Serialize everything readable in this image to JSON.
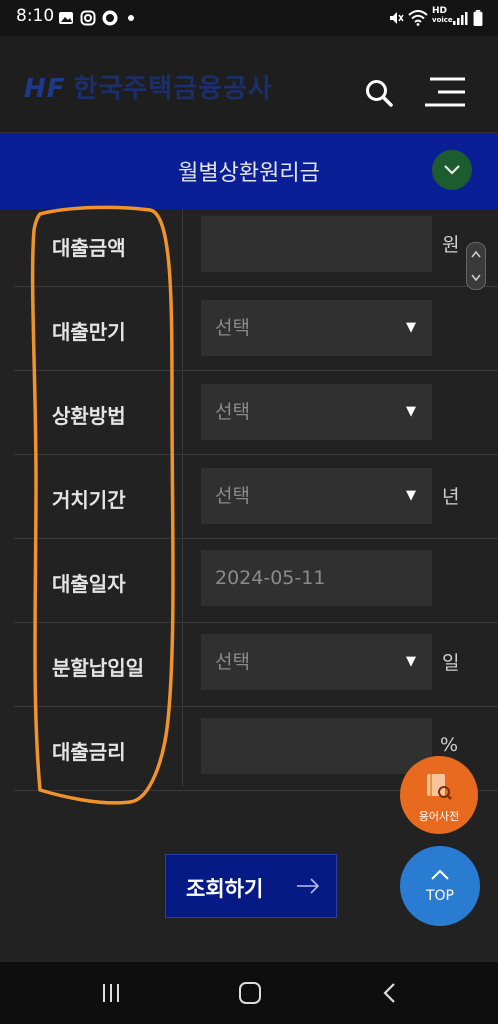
{
  "status_bar": {
    "time": "8:10",
    "icons": [
      "gallery-icon",
      "instagram-icon",
      "notification-icon",
      "dot-icon",
      "mute-icon",
      "wifi-icon",
      "hd-voice-icon",
      "signal-icon",
      "battery-icon"
    ],
    "hd_label": "HD",
    "voice_label": "voice"
  },
  "header": {
    "logo_mark": "HF",
    "logo_text": "한국주택금융공사",
    "icons": [
      "search-icon",
      "menu-icon"
    ]
  },
  "page": {
    "title": "월별상환원리금"
  },
  "form": {
    "rows": [
      {
        "label": "대출금액",
        "value": "",
        "unit": "원",
        "type": "input"
      },
      {
        "label": "대출만기",
        "value": "선택",
        "unit": "",
        "type": "select"
      },
      {
        "label": "상환방법",
        "value": "선택",
        "unit": "",
        "type": "select"
      },
      {
        "label": "거치기간",
        "value": "선택",
        "unit": "년",
        "type": "select"
      },
      {
        "label": "대출일자",
        "value": "2024-05-11",
        "unit": "",
        "type": "date"
      },
      {
        "label": "분할납입일",
        "value": "선택",
        "unit": "일",
        "type": "select"
      },
      {
        "label": "대출금리",
        "value": "",
        "unit": "%",
        "type": "input"
      }
    ]
  },
  "buttons": {
    "search_label": "조회하기",
    "dict_label": "용어사전",
    "top_label": "TOP"
  },
  "colors": {
    "title_bar": "#0a1f96",
    "highlight_stroke": "#f0932b",
    "dict_button": "#e86a1e",
    "top_button": "#2a7bd2",
    "search_button": "#061a85"
  }
}
